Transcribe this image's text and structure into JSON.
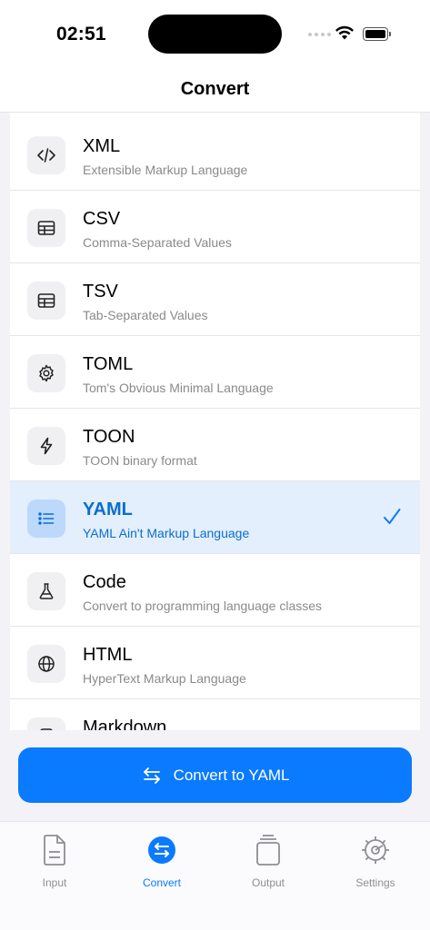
{
  "status_bar": {
    "time": "02:51"
  },
  "header": {
    "title": "Convert"
  },
  "formats": [
    {
      "name": "XML",
      "description": "Extensible Markup Language",
      "icon": "code-icon",
      "selected": false
    },
    {
      "name": "CSV",
      "description": "Comma-Separated Values",
      "icon": "table-icon",
      "selected": false
    },
    {
      "name": "TSV",
      "description": "Tab-Separated Values",
      "icon": "table-icon",
      "selected": false
    },
    {
      "name": "TOML",
      "description": "Tom's Obvious Minimal Language",
      "icon": "gear-icon",
      "selected": false
    },
    {
      "name": "TOON",
      "description": "TOON binary format",
      "icon": "bolt-icon",
      "selected": false
    },
    {
      "name": "YAML",
      "description": "YAML Ain't Markup Language",
      "icon": "list-icon",
      "selected": true
    },
    {
      "name": "Code",
      "description": "Convert to programming language classes",
      "icon": "flask-icon",
      "selected": false
    },
    {
      "name": "HTML",
      "description": "HyperText Markup Language",
      "icon": "globe-icon",
      "selected": false
    },
    {
      "name": "Markdown",
      "description": "",
      "icon": "document-icon",
      "selected": false
    }
  ],
  "convert_button": {
    "label": "Convert to YAML",
    "icon": "swap-arrows-icon"
  },
  "tabs": [
    {
      "label": "Input",
      "icon": "document-icon",
      "active": false
    },
    {
      "label": "Convert",
      "icon": "swap-circle-icon",
      "active": true
    },
    {
      "label": "Output",
      "icon": "copy-icon",
      "active": false
    },
    {
      "label": "Settings",
      "icon": "gear-icon",
      "active": false
    }
  ],
  "colors": {
    "accent": "#0a7aff",
    "selected_row": "#e3effc",
    "selected_text": "#0a6ed1"
  }
}
